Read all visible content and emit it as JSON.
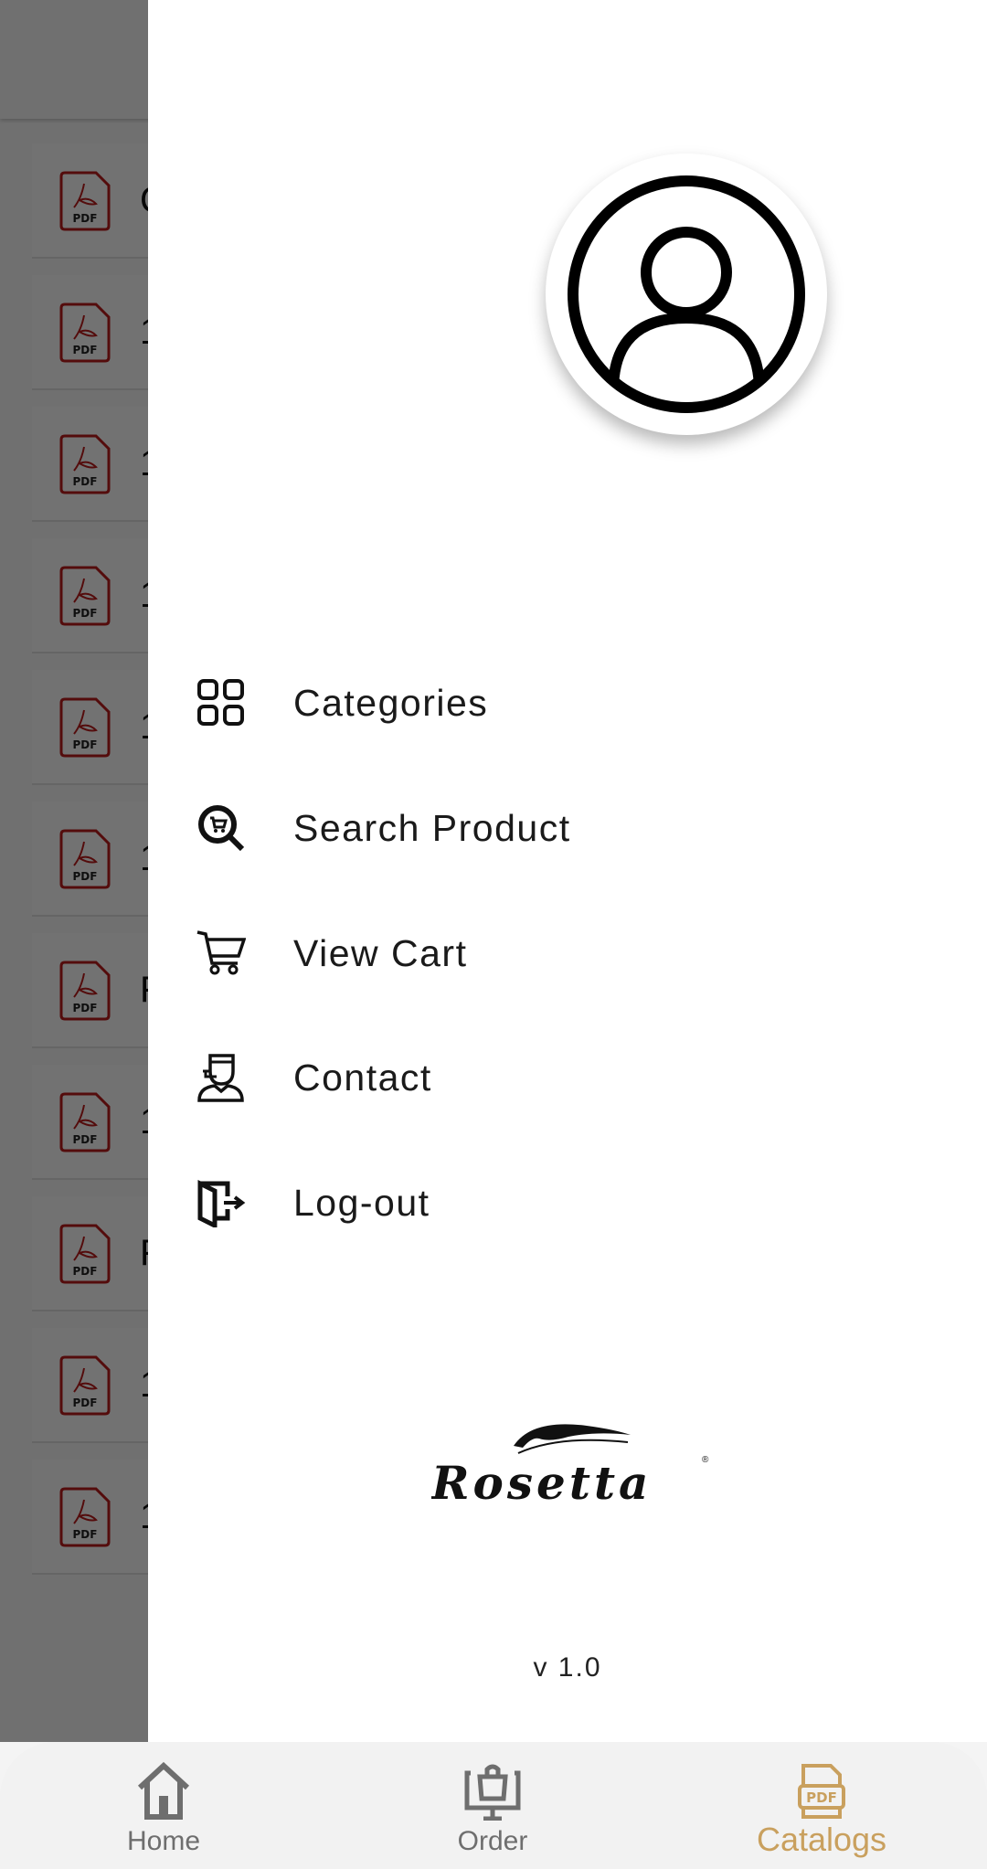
{
  "background_list": {
    "items": [
      {
        "text_partial": "C"
      },
      {
        "text_partial": "1"
      },
      {
        "text_partial": "1"
      },
      {
        "text_partial": "1"
      },
      {
        "text_partial": "1"
      },
      {
        "text_partial": "1"
      },
      {
        "text_partial": "F"
      },
      {
        "text_partial": "1"
      },
      {
        "text_partial": "F"
      },
      {
        "text_partial": "1"
      },
      {
        "text_partial": "1"
      }
    ],
    "icon": "pdf-file-icon",
    "icon_text": "PDF",
    "icon_color": "#b71c1c"
  },
  "drawer": {
    "avatar_icon": "user-circle-icon",
    "menu": [
      {
        "label": "Categories",
        "icon": "grid-icon"
      },
      {
        "label": "Search Product",
        "icon": "search-cart-icon"
      },
      {
        "label": "View Cart",
        "icon": "cart-icon"
      },
      {
        "label": "Contact",
        "icon": "support-agent-icon"
      },
      {
        "label": "Log-out",
        "icon": "logout-door-icon"
      }
    ],
    "logo_text": "Rosetta",
    "version": "v 1.0"
  },
  "bottom_nav": {
    "tabs": [
      {
        "label": "Home",
        "icon": "home-icon",
        "active": false
      },
      {
        "label": "Order",
        "icon": "order-bag-monitor-icon",
        "active": false
      },
      {
        "label": "Catalogs",
        "icon": "pdf-catalog-icon",
        "active": true
      }
    ],
    "active_color": "#c9a05e",
    "inactive_color": "#6e6e6e"
  }
}
